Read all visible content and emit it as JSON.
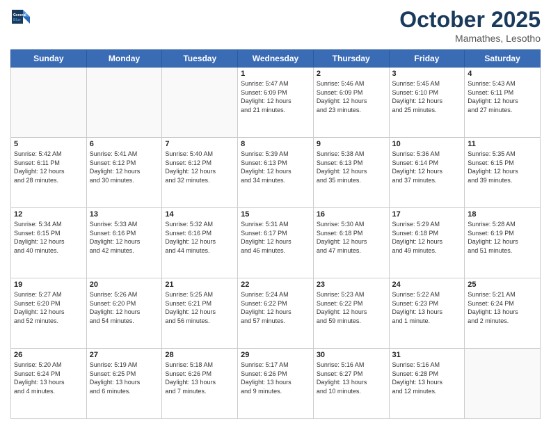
{
  "header": {
    "logo_line1": "General",
    "logo_line2": "Blue",
    "month_title": "October 2025",
    "location": "Mamathes, Lesotho"
  },
  "weekdays": [
    "Sunday",
    "Monday",
    "Tuesday",
    "Wednesday",
    "Thursday",
    "Friday",
    "Saturday"
  ],
  "weeks": [
    [
      {
        "day": "",
        "content": ""
      },
      {
        "day": "",
        "content": ""
      },
      {
        "day": "",
        "content": ""
      },
      {
        "day": "1",
        "content": "Sunrise: 5:47 AM\nSunset: 6:09 PM\nDaylight: 12 hours\nand 21 minutes."
      },
      {
        "day": "2",
        "content": "Sunrise: 5:46 AM\nSunset: 6:09 PM\nDaylight: 12 hours\nand 23 minutes."
      },
      {
        "day": "3",
        "content": "Sunrise: 5:45 AM\nSunset: 6:10 PM\nDaylight: 12 hours\nand 25 minutes."
      },
      {
        "day": "4",
        "content": "Sunrise: 5:43 AM\nSunset: 6:11 PM\nDaylight: 12 hours\nand 27 minutes."
      }
    ],
    [
      {
        "day": "5",
        "content": "Sunrise: 5:42 AM\nSunset: 6:11 PM\nDaylight: 12 hours\nand 28 minutes."
      },
      {
        "day": "6",
        "content": "Sunrise: 5:41 AM\nSunset: 6:12 PM\nDaylight: 12 hours\nand 30 minutes."
      },
      {
        "day": "7",
        "content": "Sunrise: 5:40 AM\nSunset: 6:12 PM\nDaylight: 12 hours\nand 32 minutes."
      },
      {
        "day": "8",
        "content": "Sunrise: 5:39 AM\nSunset: 6:13 PM\nDaylight: 12 hours\nand 34 minutes."
      },
      {
        "day": "9",
        "content": "Sunrise: 5:38 AM\nSunset: 6:13 PM\nDaylight: 12 hours\nand 35 minutes."
      },
      {
        "day": "10",
        "content": "Sunrise: 5:36 AM\nSunset: 6:14 PM\nDaylight: 12 hours\nand 37 minutes."
      },
      {
        "day": "11",
        "content": "Sunrise: 5:35 AM\nSunset: 6:15 PM\nDaylight: 12 hours\nand 39 minutes."
      }
    ],
    [
      {
        "day": "12",
        "content": "Sunrise: 5:34 AM\nSunset: 6:15 PM\nDaylight: 12 hours\nand 40 minutes."
      },
      {
        "day": "13",
        "content": "Sunrise: 5:33 AM\nSunset: 6:16 PM\nDaylight: 12 hours\nand 42 minutes."
      },
      {
        "day": "14",
        "content": "Sunrise: 5:32 AM\nSunset: 6:16 PM\nDaylight: 12 hours\nand 44 minutes."
      },
      {
        "day": "15",
        "content": "Sunrise: 5:31 AM\nSunset: 6:17 PM\nDaylight: 12 hours\nand 46 minutes."
      },
      {
        "day": "16",
        "content": "Sunrise: 5:30 AM\nSunset: 6:18 PM\nDaylight: 12 hours\nand 47 minutes."
      },
      {
        "day": "17",
        "content": "Sunrise: 5:29 AM\nSunset: 6:18 PM\nDaylight: 12 hours\nand 49 minutes."
      },
      {
        "day": "18",
        "content": "Sunrise: 5:28 AM\nSunset: 6:19 PM\nDaylight: 12 hours\nand 51 minutes."
      }
    ],
    [
      {
        "day": "19",
        "content": "Sunrise: 5:27 AM\nSunset: 6:20 PM\nDaylight: 12 hours\nand 52 minutes."
      },
      {
        "day": "20",
        "content": "Sunrise: 5:26 AM\nSunset: 6:20 PM\nDaylight: 12 hours\nand 54 minutes."
      },
      {
        "day": "21",
        "content": "Sunrise: 5:25 AM\nSunset: 6:21 PM\nDaylight: 12 hours\nand 56 minutes."
      },
      {
        "day": "22",
        "content": "Sunrise: 5:24 AM\nSunset: 6:22 PM\nDaylight: 12 hours\nand 57 minutes."
      },
      {
        "day": "23",
        "content": "Sunrise: 5:23 AM\nSunset: 6:22 PM\nDaylight: 12 hours\nand 59 minutes."
      },
      {
        "day": "24",
        "content": "Sunrise: 5:22 AM\nSunset: 6:23 PM\nDaylight: 13 hours\nand 1 minute."
      },
      {
        "day": "25",
        "content": "Sunrise: 5:21 AM\nSunset: 6:24 PM\nDaylight: 13 hours\nand 2 minutes."
      }
    ],
    [
      {
        "day": "26",
        "content": "Sunrise: 5:20 AM\nSunset: 6:24 PM\nDaylight: 13 hours\nand 4 minutes."
      },
      {
        "day": "27",
        "content": "Sunrise: 5:19 AM\nSunset: 6:25 PM\nDaylight: 13 hours\nand 6 minutes."
      },
      {
        "day": "28",
        "content": "Sunrise: 5:18 AM\nSunset: 6:26 PM\nDaylight: 13 hours\nand 7 minutes."
      },
      {
        "day": "29",
        "content": "Sunrise: 5:17 AM\nSunset: 6:26 PM\nDaylight: 13 hours\nand 9 minutes."
      },
      {
        "day": "30",
        "content": "Sunrise: 5:16 AM\nSunset: 6:27 PM\nDaylight: 13 hours\nand 10 minutes."
      },
      {
        "day": "31",
        "content": "Sunrise: 5:16 AM\nSunset: 6:28 PM\nDaylight: 13 hours\nand 12 minutes."
      },
      {
        "day": "",
        "content": ""
      }
    ]
  ]
}
